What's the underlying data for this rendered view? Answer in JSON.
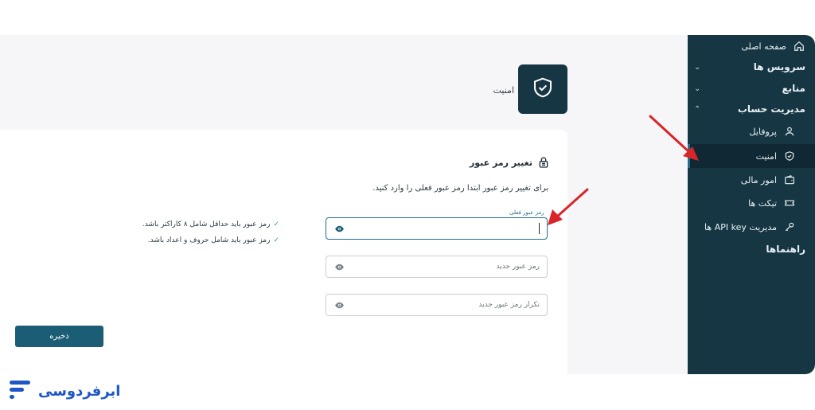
{
  "sidebar": {
    "items": [
      {
        "label": "صفحه اصلی",
        "icon": "home-icon"
      },
      {
        "label": "سرویس ها",
        "icon": "chevron-down-icon"
      },
      {
        "label": "منابع",
        "icon": "chevron-down-icon"
      },
      {
        "label": "مدیریت حساب",
        "icon": "chevron-up-icon"
      },
      {
        "label": "پروفایل",
        "icon": "user-icon"
      },
      {
        "label": "امنیت",
        "icon": "shield-check-icon"
      },
      {
        "label": "امور مالی",
        "icon": "wallet-icon"
      },
      {
        "label": "تیکت ها",
        "icon": "ticket-icon"
      },
      {
        "label": "مدیریت API key ها",
        "icon": "key-icon"
      },
      {
        "label": "راهنماها",
        "icon": ""
      }
    ]
  },
  "header": {
    "title": "امنیت",
    "icon": "shield-check-icon"
  },
  "section": {
    "title": "تغییر رمز عبور",
    "icon": "lock-icon",
    "description": "برای تغییر رمز عبور ابتدا رمز عبور فعلی را وارد کنید."
  },
  "form": {
    "current": {
      "label": "رمز عبور فعلی",
      "value": ""
    },
    "new": {
      "placeholder": "رمز عبور جدید"
    },
    "confirm": {
      "placeholder": "تکرار رمز عبور جدید"
    },
    "rules": [
      "رمز عبور باید حداقل شامل ۸ کاراکتر باشد.",
      "رمز عبور باید شامل حروف و اعداد باشد."
    ],
    "save_label": "ذخیره"
  },
  "brand": {
    "name": "ابرفردوسی"
  },
  "colors": {
    "sidebar": "#163644",
    "accent": "#1a5d75",
    "arrow": "#d9252a",
    "brand": "#1e56c8"
  }
}
